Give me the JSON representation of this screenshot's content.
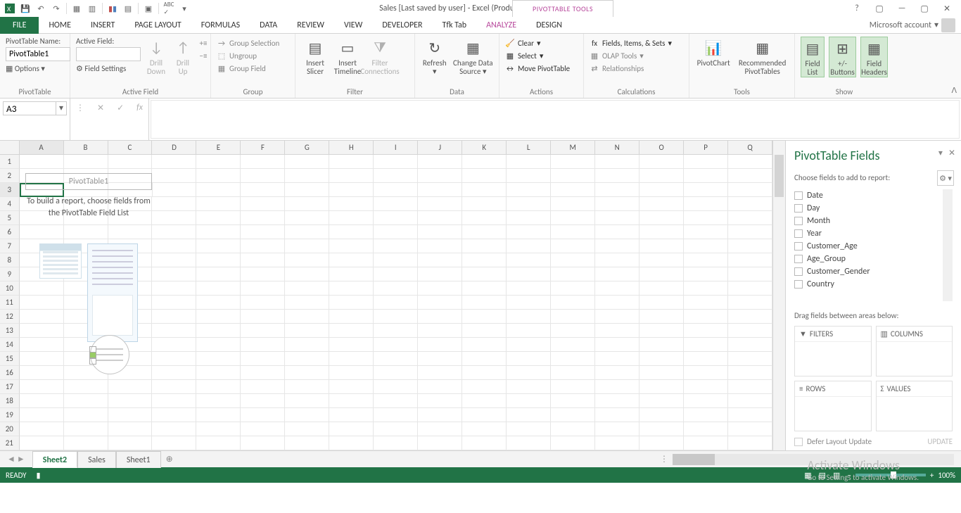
{
  "title": "Sales [Last saved by user] - Excel (Product Activation Failed)",
  "pivottable_tools": "PIVOTTABLE TOOLS",
  "tabs": {
    "file": "FILE",
    "home": "HOME",
    "insert": "INSERT",
    "page_layout": "PAGE LAYOUT",
    "formulas": "FORMULAS",
    "data": "DATA",
    "review": "REVIEW",
    "view": "VIEW",
    "developer": "DEVELOPER",
    "tfk": "Tfk Tab",
    "analyze": "ANALYZE",
    "design": "DESIGN"
  },
  "account": "Microsoft account",
  "ribbon": {
    "pivottable": {
      "name_label": "PivotTable Name:",
      "name_value": "PivotTable1",
      "options": "Options",
      "group": "PivotTable"
    },
    "activefield": {
      "label": "Active Field:",
      "value": "",
      "field_settings": "Field Settings",
      "drill_down": "Drill Down",
      "drill_up": "Drill Up",
      "group": "Active Field"
    },
    "grp": {
      "group_selection": "Group Selection",
      "ungroup": "Ungroup",
      "group_field": "Group Field",
      "group": "Group"
    },
    "filter": {
      "insert_slicer": "Insert Slicer",
      "insert_timeline": "Insert Timeline",
      "filter_connections": "Filter Connections",
      "group": "Filter"
    },
    "data": {
      "refresh": "Refresh",
      "change_source": "Change Data Source",
      "group": "Data"
    },
    "actions": {
      "clear": "Clear",
      "select": "Select",
      "move": "Move PivotTable",
      "group": "Actions"
    },
    "calc": {
      "fields": "Fields, Items, & Sets",
      "olap": "OLAP Tools",
      "rel": "Relationships",
      "group": "Calculations"
    },
    "tools": {
      "pivotchart": "PivotChart",
      "recommended": "Recommended PivotTables",
      "group": "Tools"
    },
    "show": {
      "field_list": "Field List",
      "buttons": "+/- Buttons",
      "headers": "Field Headers",
      "group": "Show"
    }
  },
  "namebox": "A3",
  "columns": [
    "A",
    "B",
    "C",
    "D",
    "E",
    "F",
    "G",
    "H",
    "I",
    "J",
    "K",
    "L",
    "M",
    "N",
    "O",
    "P",
    "Q"
  ],
  "rows": [
    1,
    2,
    3,
    4,
    5,
    6,
    7,
    8,
    9,
    10,
    11,
    12,
    13,
    14,
    15,
    16,
    17,
    18,
    19,
    20,
    21
  ],
  "placeholder": {
    "title": "PivotTable1",
    "hint": "To build a report, choose fields from the PivotTable Field List"
  },
  "fieldpane": {
    "title": "PivotTable Fields",
    "sub": "Choose fields to add to report:",
    "fields": [
      "Date",
      "Day",
      "Month",
      "Year",
      "Customer_Age",
      "Age_Group",
      "Customer_Gender",
      "Country"
    ],
    "drag": "Drag fields between areas below:",
    "filters": "FILTERS",
    "columns": "COLUMNS",
    "rowsa": "ROWS",
    "values": "VALUES",
    "defer": "Defer Layout Update",
    "update": "UPDATE"
  },
  "sheets": {
    "active": "Sheet2",
    "sales": "Sales",
    "sheet1": "Sheet1"
  },
  "status": {
    "ready": "READY",
    "zoom": "100%"
  },
  "watermark": {
    "l1": "Activate Windows",
    "l2": "Go to Settings to activate Windows."
  }
}
